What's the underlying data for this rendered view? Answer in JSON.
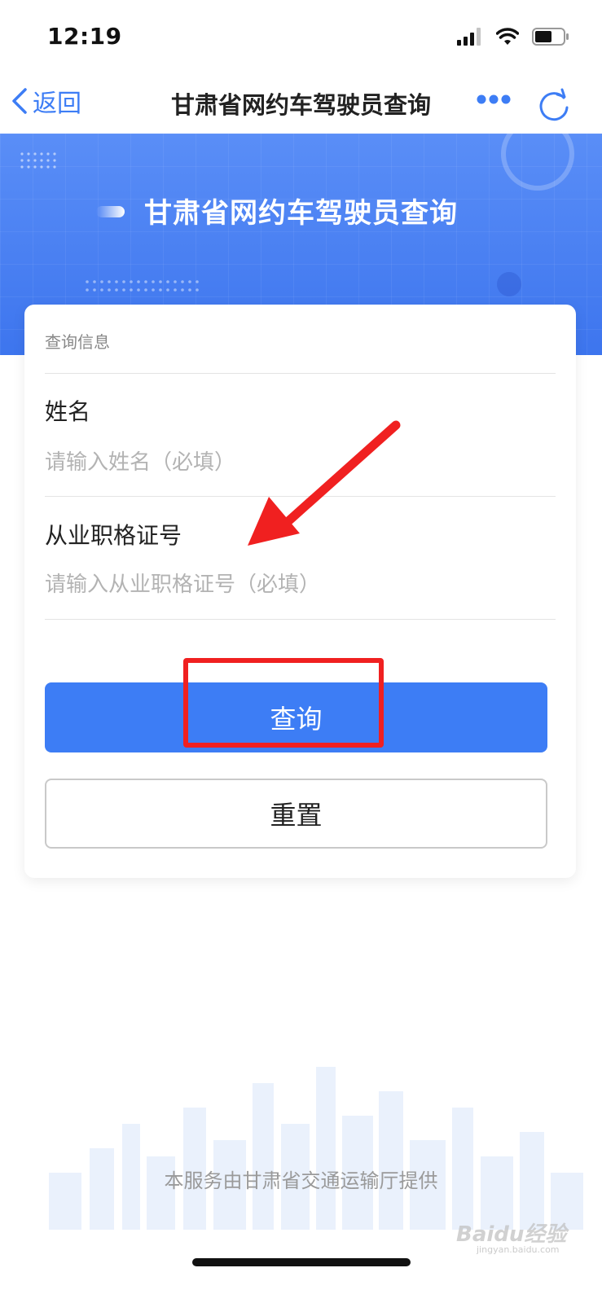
{
  "status_bar": {
    "time": "12:19",
    "icons": [
      "signal-icon",
      "wifi-icon",
      "battery-icon"
    ]
  },
  "nav": {
    "back_label": "返回",
    "title": "甘肃省网约车驾驶员查询",
    "more_icon": "more-dots-icon",
    "refresh_icon": "refresh-icon"
  },
  "banner": {
    "title": "甘肃省网约车驾驶员查询"
  },
  "form": {
    "section_title": "查询信息",
    "name_label": "姓名",
    "name_value": "",
    "name_placeholder": "请输入姓名（必填）",
    "cert_label": "从业职格证号",
    "cert_value": "",
    "cert_placeholder": "请输入从业职格证号（必填）",
    "query_button": "查询",
    "reset_button": "重置"
  },
  "footer": {
    "provider": "本服务由甘肃省交通运输厅提供"
  },
  "watermark": {
    "text": "Baidu经验",
    "sub": "jingyan.baidu.com"
  },
  "colors": {
    "primary": "#3d7df5",
    "banner_top": "#5a8ef7",
    "banner_bottom": "#3d75ee",
    "annotation": "#f02020",
    "placeholder": "#b3b3b3"
  }
}
